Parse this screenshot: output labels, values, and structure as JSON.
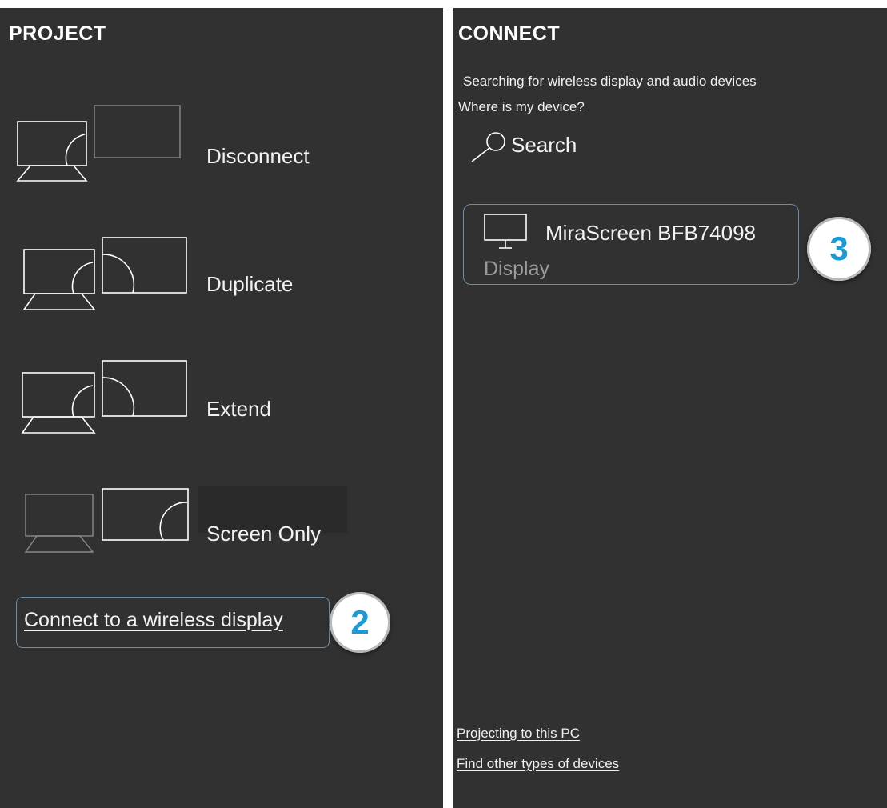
{
  "project": {
    "title": "PROJECT",
    "modes": [
      {
        "label": "Disconnect"
      },
      {
        "label": "Duplicate"
      },
      {
        "label": "Extend"
      },
      {
        "label": "Screen Only"
      }
    ],
    "wireless_link": "Connect to a wireless display",
    "step_badge": "2"
  },
  "connect": {
    "title": "CONNECT",
    "status": "Searching for wireless display and audio devices",
    "where_link": "Where is my device?",
    "search_label": "Search",
    "device": {
      "name": "MiraScreen BFB74098",
      "type": "Display"
    },
    "step_badge": "3",
    "projecting_link": "Projecting to this PC",
    "find_other_link": "Find other types of devices"
  },
  "colors": {
    "panel_bg": "#313131",
    "accent_border": "#6b8fa9",
    "badge_number": "#1b9ad6"
  }
}
